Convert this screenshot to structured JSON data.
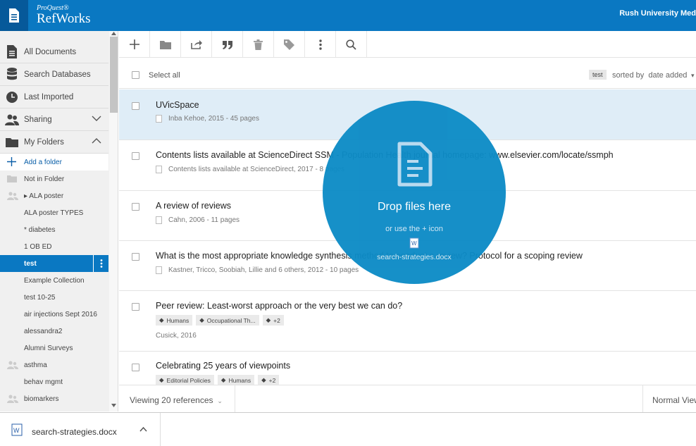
{
  "header": {
    "brand_small": "ProQuest®",
    "brand_name": "RefWorks",
    "institution": "Rush University Med"
  },
  "sidebar": {
    "nav": [
      {
        "label": "All Documents",
        "icon": "document-icon"
      },
      {
        "label": "Search Databases",
        "icon": "database-icon"
      },
      {
        "label": "Last Imported",
        "icon": "clock-icon"
      },
      {
        "label": "Sharing",
        "icon": "people-icon"
      },
      {
        "label": "My Folders",
        "icon": "folder-icon"
      }
    ],
    "add_folder": "Add a folder",
    "folders": [
      {
        "label": "Not in Folder"
      },
      {
        "label": "▸ ALA poster"
      },
      {
        "label": "ALA poster TYPES"
      },
      {
        "label": "* diabetes"
      },
      {
        "label": "1 OB ED"
      },
      {
        "label": "test"
      },
      {
        "label": "Example Collection"
      },
      {
        "label": "test 10-25"
      },
      {
        "label": "air injections Sept 2016"
      },
      {
        "label": "alessandra2"
      },
      {
        "label": "Alumni Surveys"
      },
      {
        "label": "asthma"
      },
      {
        "label": "behav mgmt"
      },
      {
        "label": "biomarkers"
      }
    ]
  },
  "list": {
    "select_all": "Select all",
    "sort_tag": "test",
    "sorted_by": "sorted by",
    "sort_field": "date added",
    "refs": [
      {
        "title": "UVicSpace",
        "meta": "Inba Kehoe, 2015 - 45 pages"
      },
      {
        "title": "Contents lists available at ScienceDirect SSM - Population Health journal homepage: www.elsevier.com/locate/ssmph",
        "meta": "Contents lists available at ScienceDirect, 2017 - 8 pages"
      },
      {
        "title": "A review of reviews",
        "meta": "Cahn, 2006 - 11 pages"
      },
      {
        "title": "What is the most appropriate knowledge synthesis method to conduct a review? Protocol for a scoping review",
        "meta": "Kastner, Tricco, Soobiah, Lillie and 6 others, 2012 - 10 pages"
      },
      {
        "title": "Peer review: Least-worst approach or the very best we can do?",
        "tags": [
          "Humans",
          "Occupational Th...",
          "+2"
        ],
        "meta": "Cusick, 2016"
      },
      {
        "title": "Celebrating 25 years of viewpoints",
        "tags": [
          "Editorial Policies",
          "Humans",
          "+2"
        ]
      }
    ],
    "viewing": "Viewing 20 references",
    "view_mode": "Normal View"
  },
  "drop": {
    "title": "Drop files here",
    "subtitle": "or use the + icon",
    "file_name": "search-strategies.docx"
  },
  "download": {
    "file_name": "search-strategies.docx"
  },
  "colors": {
    "header": "#0a78c2",
    "drop_circle": "#0d8bc6",
    "active_folder": "#0a78c2",
    "selected_row": "#dfedf7"
  }
}
